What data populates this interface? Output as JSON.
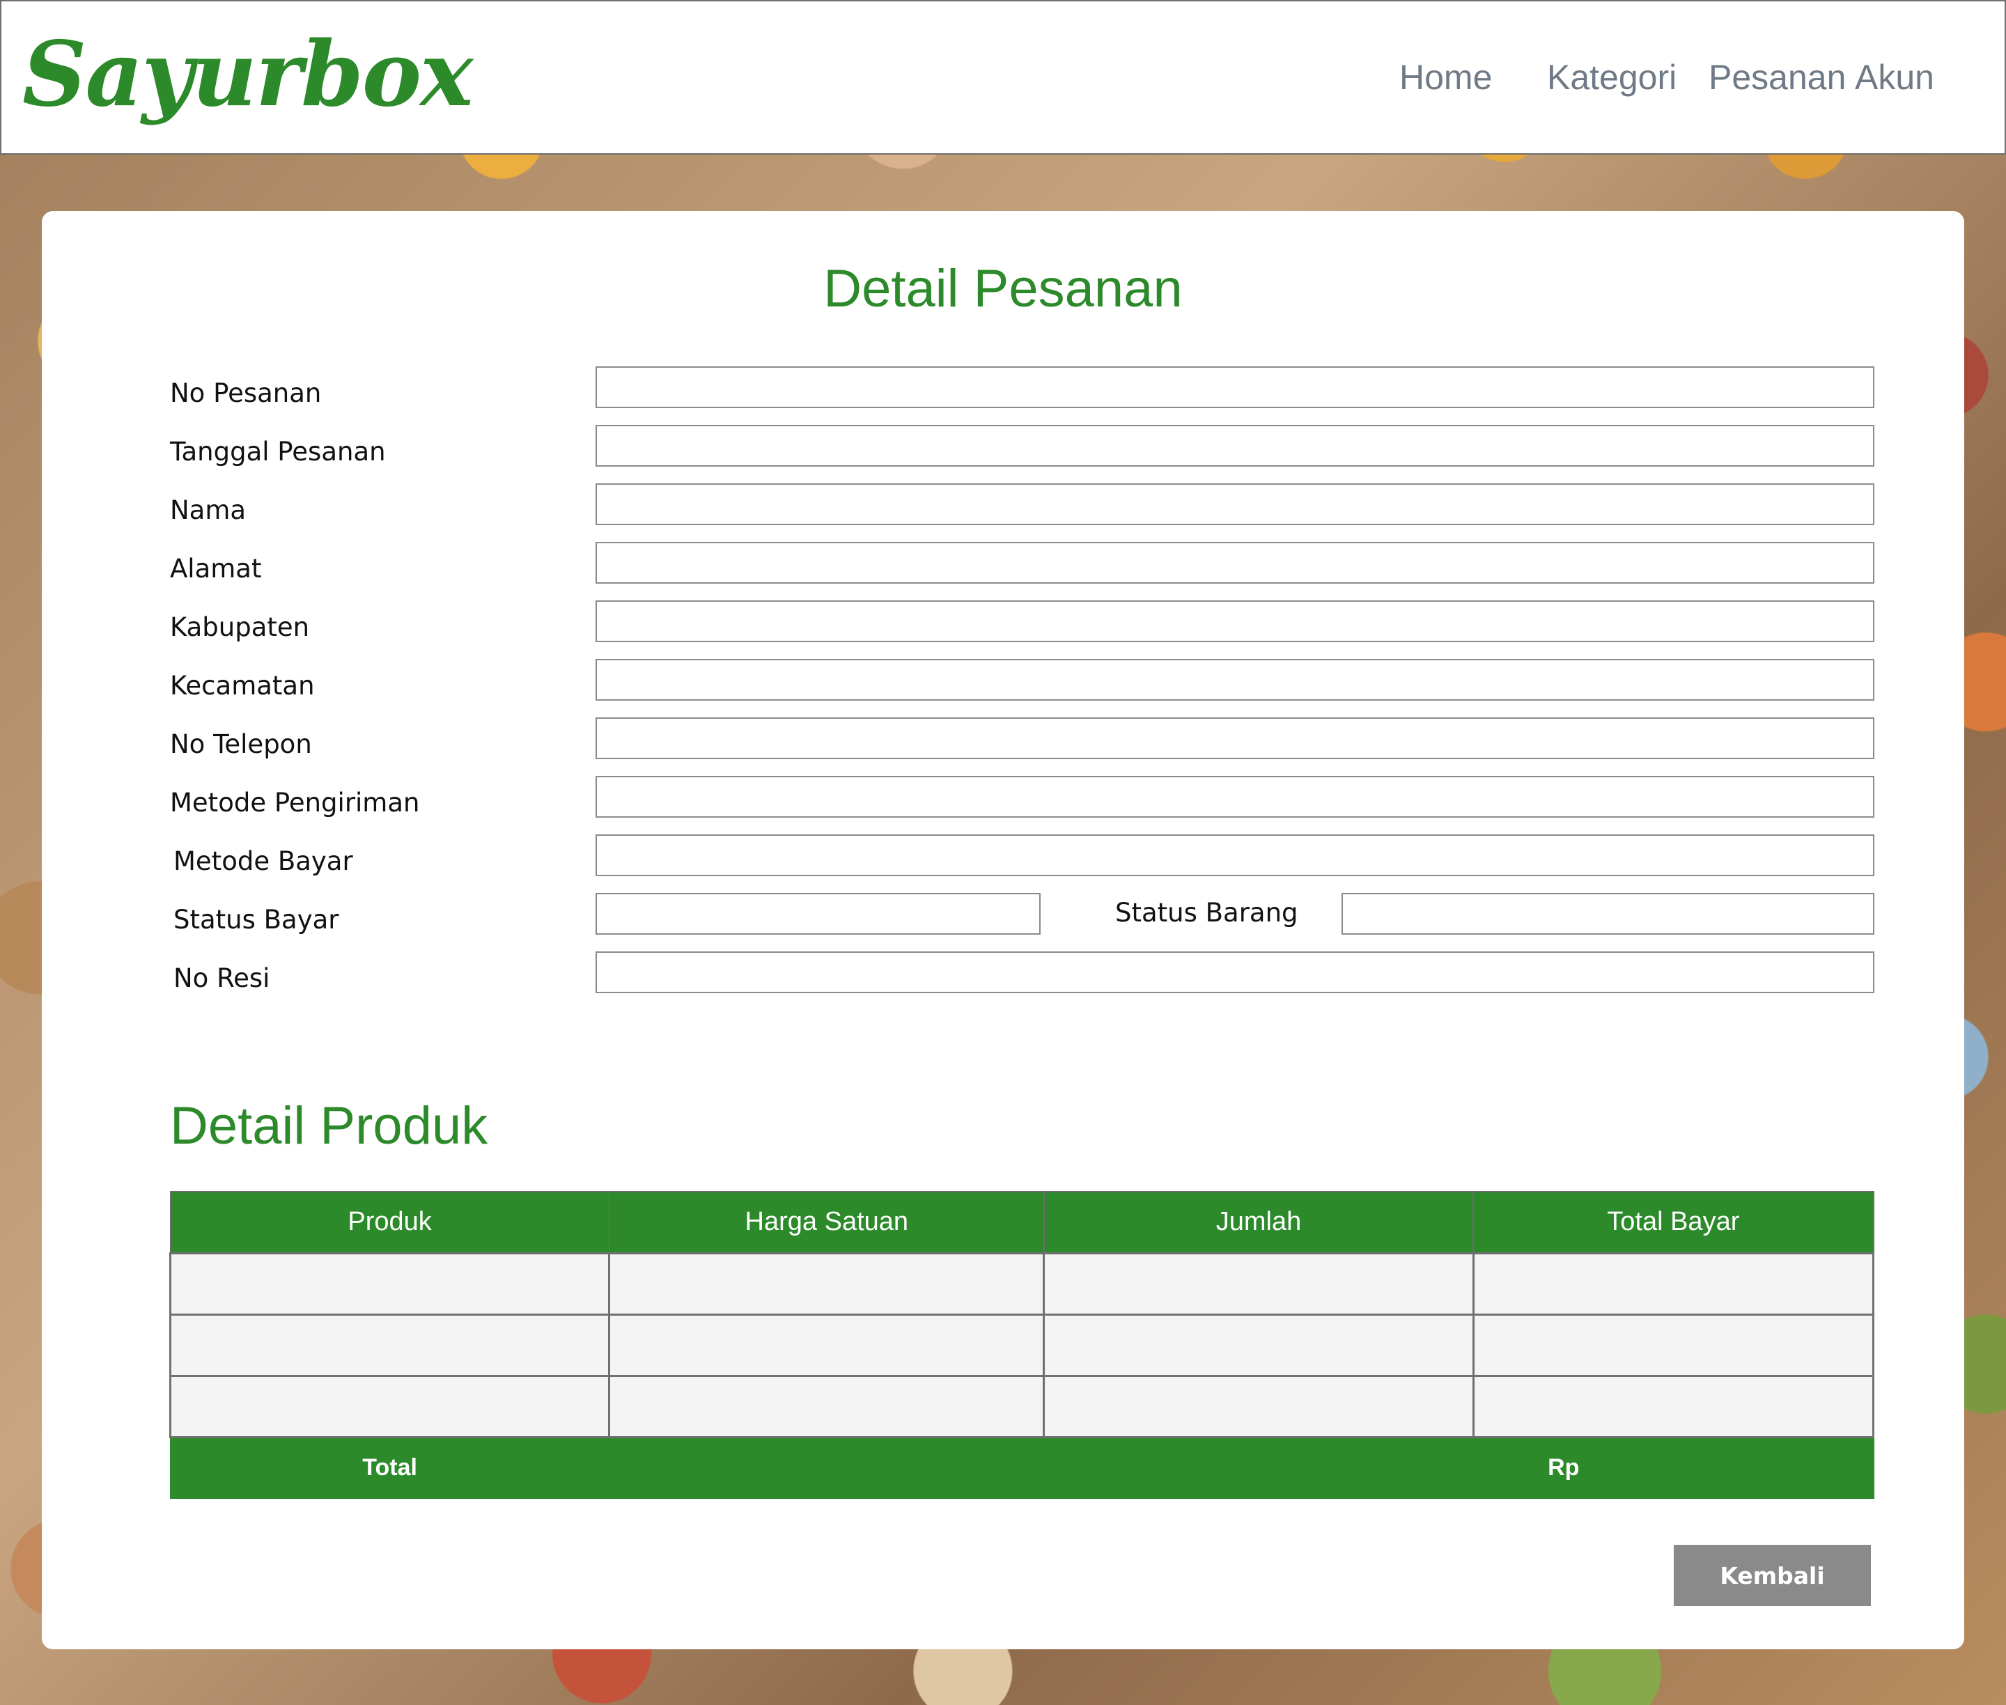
{
  "header": {
    "logo": "Sayurbox",
    "nav": [
      "Home",
      "Kategori",
      "Pesanan",
      "Akun"
    ]
  },
  "order": {
    "title": "Detail Pesanan",
    "fields": {
      "no_pesanan": {
        "label": "No Pesanan",
        "value": ""
      },
      "tanggal_pesanan": {
        "label": "Tanggal Pesanan",
        "value": ""
      },
      "nama": {
        "label": "Nama",
        "value": ""
      },
      "alamat": {
        "label": "Alamat",
        "value": ""
      },
      "kabupaten": {
        "label": "Kabupaten",
        "value": ""
      },
      "kecamatan": {
        "label": "Kecamatan",
        "value": ""
      },
      "no_telepon": {
        "label": "No Telepon",
        "value": ""
      },
      "metode_pengiriman": {
        "label": "Metode Pengiriman",
        "value": ""
      },
      "metode_bayar": {
        "label": "Metode Bayar",
        "value": ""
      },
      "status_bayar": {
        "label": "Status Bayar",
        "value": ""
      },
      "status_barang": {
        "label": "Status Barang",
        "value": ""
      },
      "no_resi": {
        "label": "No Resi",
        "value": ""
      }
    }
  },
  "products": {
    "title": "Detail Produk",
    "columns": [
      "Produk",
      "Harga Satuan",
      "Jumlah",
      "Total Bayar"
    ],
    "rows": [
      [
        "",
        "",
        "",
        ""
      ],
      [
        "",
        "",
        "",
        ""
      ],
      [
        "",
        "",
        "",
        ""
      ]
    ],
    "total_label": "Total",
    "total_value": "Rp"
  },
  "back_button": "Kembali",
  "colors": {
    "brand_green": "#2c8a2a",
    "button_gray": "#8a8a8a"
  }
}
